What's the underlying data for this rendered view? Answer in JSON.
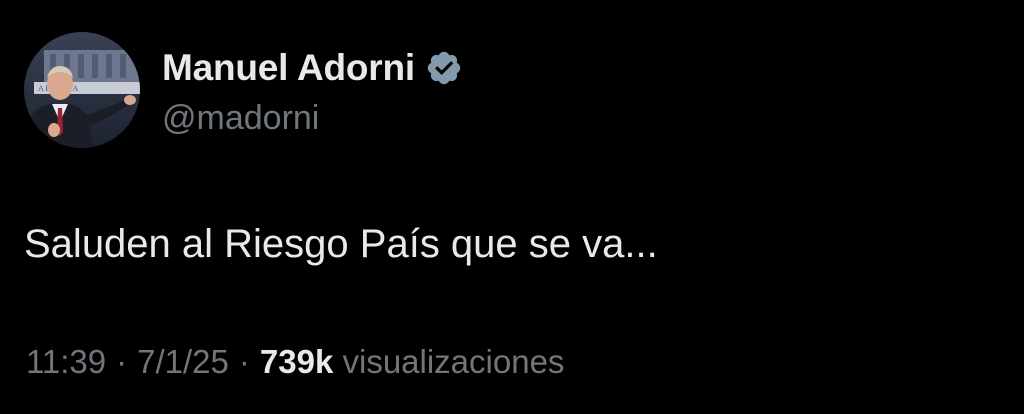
{
  "author": {
    "display_name": "Manuel Adorni",
    "handle": "@madorni",
    "verified": true,
    "avatar_backdrop_text": "A ROSADA"
  },
  "tweet": {
    "text": "Saluden al Riesgo País que se va..."
  },
  "meta": {
    "time": "11:39",
    "separator": "·",
    "date": "7/1/25",
    "views_count": "739k",
    "views_label": "visualizaciones"
  },
  "colors": {
    "background": "#000000",
    "primary_text": "#e7e9ea",
    "secondary_text": "#71767b",
    "verified_badge": "#829aab"
  }
}
